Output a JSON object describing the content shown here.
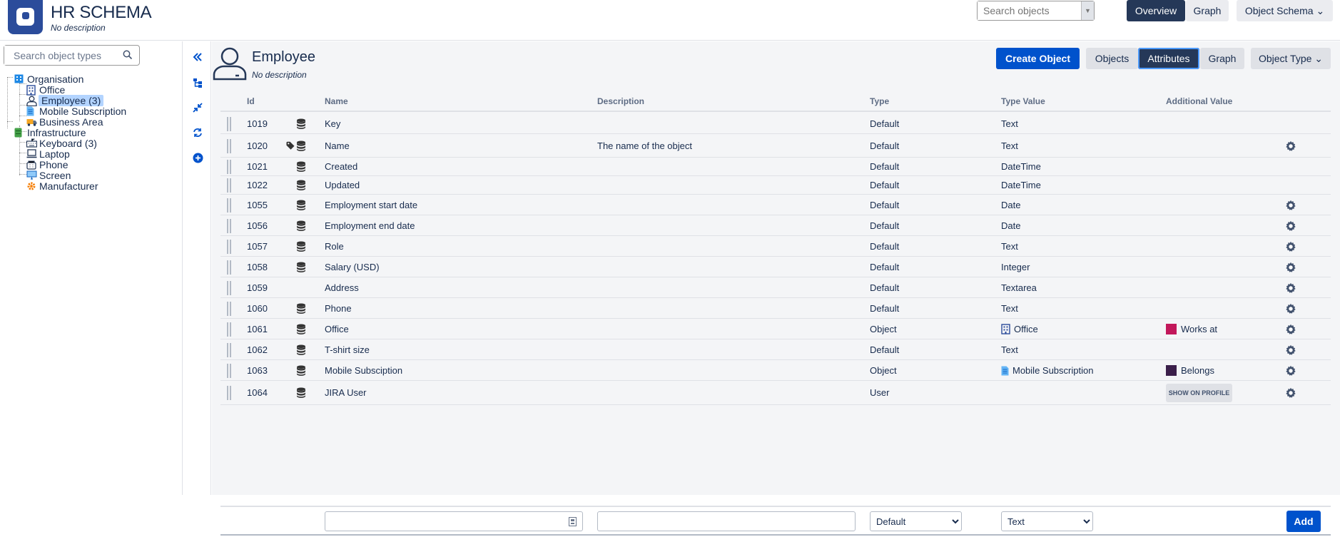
{
  "schema": {
    "title": "HR SCHEMA",
    "description": "No description"
  },
  "header": {
    "search_placeholder": "Search objects",
    "overview_label": "Overview",
    "graph_label": "Graph",
    "object_schema_label": "Object Schema"
  },
  "sidebar": {
    "search_placeholder": "Search object types",
    "tree": [
      {
        "label": "Organisation",
        "icon": "building-icon",
        "level": 0,
        "selected": false
      },
      {
        "label": "Office",
        "icon": "office-icon",
        "level": 1,
        "selected": false
      },
      {
        "label": "Employee (3)",
        "icon": "employee-icon",
        "level": 1,
        "selected": true
      },
      {
        "label": "Mobile Subscription",
        "icon": "document-icon",
        "level": 1,
        "selected": false
      },
      {
        "label": "Business Area",
        "icon": "truck-icon",
        "level": 1,
        "selected": false
      },
      {
        "label": "Infrastructure",
        "icon": "server-icon",
        "level": 0,
        "selected": false
      },
      {
        "label": "Keyboard (3)",
        "icon": "keyboard-icon",
        "level": 1,
        "selected": false
      },
      {
        "label": "Laptop",
        "icon": "laptop-icon",
        "level": 1,
        "selected": false
      },
      {
        "label": "Phone",
        "icon": "phone-icon",
        "level": 1,
        "selected": false
      },
      {
        "label": "Screen",
        "icon": "screen-icon",
        "level": 1,
        "selected": false
      },
      {
        "label": "Manufacturer",
        "icon": "factory-icon",
        "level": 1,
        "selected": false
      }
    ]
  },
  "rail": [
    "collapse-icon",
    "hierarchy-icon",
    "compress-icon",
    "refresh-icon",
    "add-circle-icon"
  ],
  "object_type": {
    "title": "Employee",
    "description": "No description",
    "create_label": "Create Object",
    "objects_label": "Objects",
    "attributes_label": "Attributes",
    "graph_label": "Graph",
    "object_type_label": "Object Type"
  },
  "table": {
    "headers": {
      "id": "Id",
      "name": "Name",
      "description": "Description",
      "type": "Type",
      "type_value": "Type Value",
      "additional": "Additional Value"
    },
    "rows": [
      {
        "id": "1019",
        "name": "Key",
        "description": "",
        "type": "Default",
        "type_value": "Text",
        "additional": "",
        "db_icon": true,
        "tag_icon": false,
        "gear": false
      },
      {
        "id": "1020",
        "name": "Name",
        "description": "The name of the object",
        "type": "Default",
        "type_value": "Text",
        "additional": "",
        "db_icon": true,
        "tag_icon": true,
        "gear": true
      },
      {
        "id": "1021",
        "name": "Created",
        "description": "",
        "type": "Default",
        "type_value": "DateTime",
        "additional": "",
        "db_icon": true,
        "tag_icon": false,
        "gear": false
      },
      {
        "id": "1022",
        "name": "Updated",
        "description": "",
        "type": "Default",
        "type_value": "DateTime",
        "additional": "",
        "db_icon": true,
        "tag_icon": false,
        "gear": false
      },
      {
        "id": "1055",
        "name": "Employment start date",
        "description": "",
        "type": "Default",
        "type_value": "Date",
        "additional": "",
        "db_icon": true,
        "tag_icon": false,
        "gear": true
      },
      {
        "id": "1056",
        "name": "Employment end date",
        "description": "",
        "type": "Default",
        "type_value": "Date",
        "additional": "",
        "db_icon": true,
        "tag_icon": false,
        "gear": true
      },
      {
        "id": "1057",
        "name": "Role",
        "description": "",
        "type": "Default",
        "type_value": "Text",
        "additional": "",
        "db_icon": true,
        "tag_icon": false,
        "gear": true
      },
      {
        "id": "1058",
        "name": "Salary (USD)",
        "description": "",
        "type": "Default",
        "type_value": "Integer",
        "additional": "",
        "db_icon": true,
        "tag_icon": false,
        "gear": true
      },
      {
        "id": "1059",
        "name": "Address",
        "description": "",
        "type": "Default",
        "type_value": "Textarea",
        "additional": "",
        "db_icon": false,
        "tag_icon": false,
        "gear": true
      },
      {
        "id": "1060",
        "name": "Phone",
        "description": "",
        "type": "Default",
        "type_value": "Text",
        "additional": "",
        "db_icon": true,
        "tag_icon": false,
        "gear": true
      },
      {
        "id": "1061",
        "name": "Office",
        "description": "",
        "type": "Object",
        "type_value": "Office",
        "type_value_icon": "office-icon",
        "additional": "Works at",
        "additional_color": "#c2185b",
        "db_icon": true,
        "tag_icon": false,
        "gear": true
      },
      {
        "id": "1062",
        "name": "T-shirt size",
        "description": "",
        "type": "Default",
        "type_value": "Text",
        "additional": "",
        "db_icon": true,
        "tag_icon": false,
        "gear": true
      },
      {
        "id": "1063",
        "name": "Mobile Subsciption",
        "description": "",
        "type": "Object",
        "type_value": "Mobile Subscription",
        "type_value_icon": "document-icon",
        "additional": "Belongs",
        "additional_color": "#3b1f4a",
        "db_icon": true,
        "tag_icon": false,
        "gear": true
      },
      {
        "id": "1064",
        "name": "JIRA User",
        "description": "",
        "type": "User",
        "type_value": "",
        "additional_button": "SHOW ON PROFILE",
        "db_icon": true,
        "tag_icon": false,
        "gear": true
      }
    ]
  },
  "add_row": {
    "type_selected": "Default",
    "type_value_selected": "Text",
    "add_label": "Add"
  },
  "colors": {
    "primary": "#0052cc",
    "dark": "#253858",
    "selected_tree": "#b3d4ff"
  }
}
